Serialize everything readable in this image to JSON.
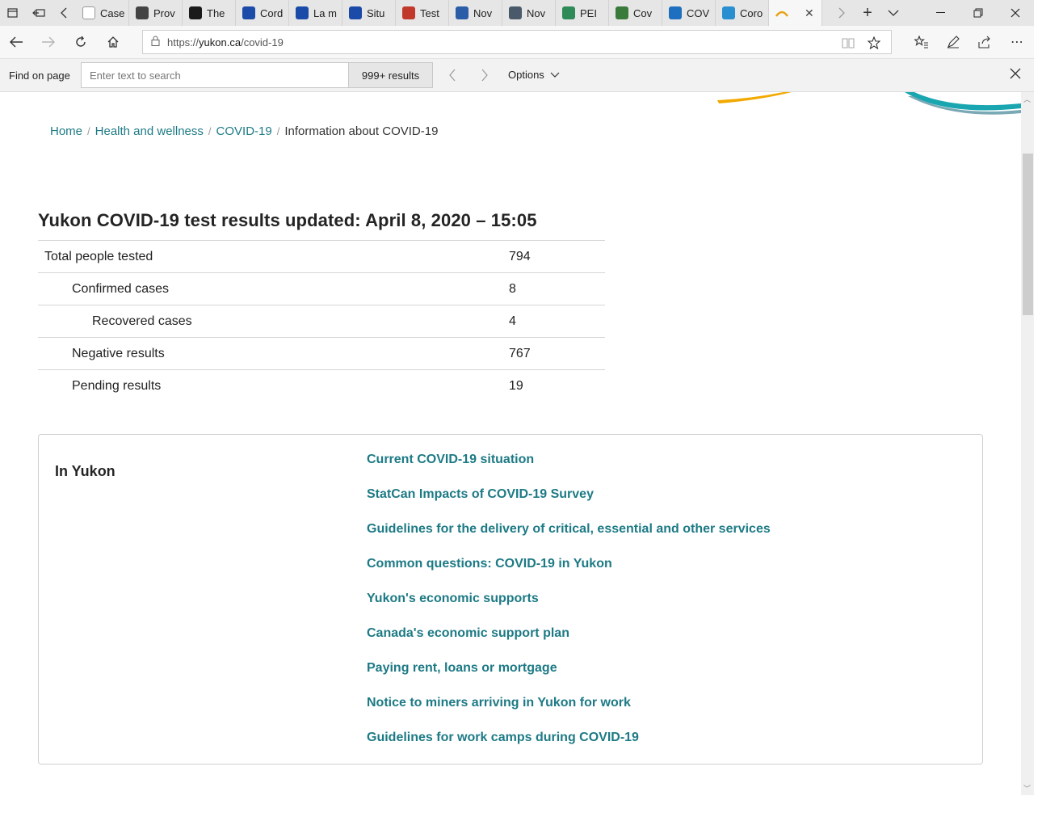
{
  "browser": {
    "tabs": [
      {
        "title": "Case",
        "icon": "generic-page-icon",
        "color": "#ffffff"
      },
      {
        "title": "Prov",
        "icon": "province-icon",
        "color": "#444444"
      },
      {
        "title": "The",
        "icon": "shield-icon",
        "color": "#1a1a1a"
      },
      {
        "title": "Cord",
        "icon": "fleur-de-lis-icon",
        "color": "#1b4aa8"
      },
      {
        "title": "La m",
        "icon": "fleur-de-lis-icon",
        "color": "#1b4aa8"
      },
      {
        "title": "Situ",
        "icon": "fleur-de-lis-icon",
        "color": "#1b4aa8"
      },
      {
        "title": "Test",
        "icon": "pdf-icon",
        "color": "#c0392b"
      },
      {
        "title": "Nov",
        "icon": "flag-icon",
        "color": "#2b5ca8"
      },
      {
        "title": "Nov",
        "icon": "document-icon",
        "color": "#4a5a6a"
      },
      {
        "title": "PEI",
        "icon": "pei-icon",
        "color": "#2e8b57"
      },
      {
        "title": "Cov",
        "icon": "globe-icon",
        "color": "#3a7a3a"
      },
      {
        "title": "COV",
        "icon": "circle-icon",
        "color": "#1e6fbf"
      },
      {
        "title": "Coro",
        "icon": "arc-icon",
        "color": "#2a8fd0"
      }
    ],
    "active_tab": {
      "icon": "yukon-icon",
      "color": "#e8a317"
    },
    "address": {
      "scheme": "https://",
      "host": "yukon.ca",
      "path": "/covid-19"
    },
    "find": {
      "label": "Find on page",
      "placeholder": "Enter text to search",
      "count": "999+ results",
      "options_label": "Options"
    }
  },
  "breadcrumb": {
    "home": "Home",
    "health": "Health and wellness",
    "covid": "COVID-19",
    "current": "Information about COVID-19",
    "separator": "/"
  },
  "results": {
    "heading": "Yukon COVID-19 test results updated: April 8, 2020 – 15:05",
    "rows": [
      {
        "label": "Total people tested",
        "value": "794",
        "level": 0
      },
      {
        "label": "Confirmed cases",
        "value": "8",
        "level": 1
      },
      {
        "label": "Recovered cases",
        "value": "4",
        "level": 2
      },
      {
        "label": "Negative results",
        "value": "767",
        "level": 1
      },
      {
        "label": "Pending results",
        "value": "19",
        "level": 1
      }
    ]
  },
  "in_yukon": {
    "title": "In Yukon",
    "links": [
      "Current COVID-19 situation",
      "StatCan Impacts of COVID-19 Survey",
      "Guidelines for the delivery of critical, essential and other services",
      "Common questions: COVID-19 in Yukon",
      "Yukon's economic supports",
      "Canada's economic support plan",
      "Paying rent, loans or mortgage",
      "Notice to miners arriving in Yukon for work",
      "Guidelines for work camps during COVID-19"
    ]
  },
  "colors": {
    "link": "#1d7a85",
    "brand_teal": "#1aa6b0",
    "brand_gold": "#f2a900"
  }
}
